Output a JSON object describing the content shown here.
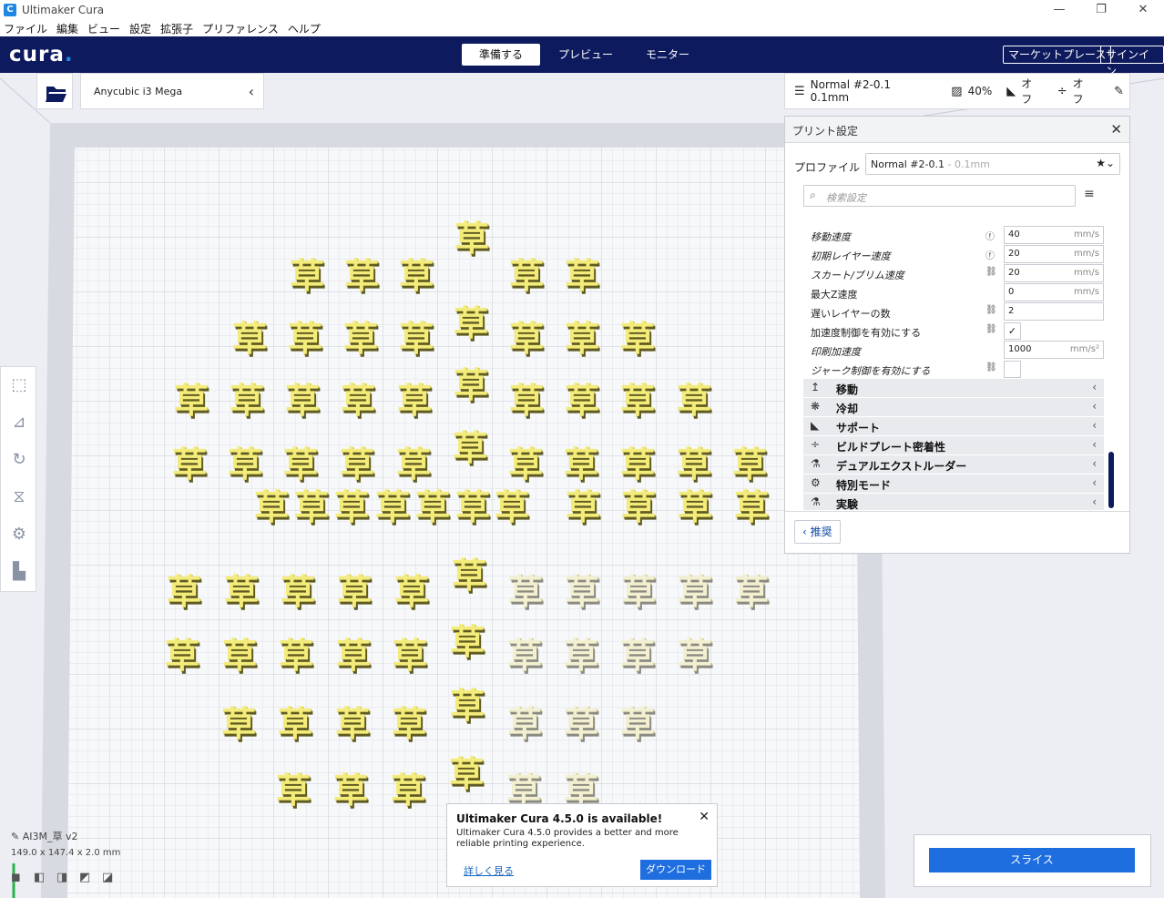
{
  "window": {
    "title": "Ultimaker Cura",
    "icon_glyph": "C"
  },
  "menu": [
    "ファイル",
    "編集",
    "ビュー",
    "設定",
    "拡張子",
    "プリファレンス",
    "ヘルプ"
  ],
  "header": {
    "logo": "cura",
    "logo_dot": ".",
    "stages": [
      "準備する",
      "プレビュー",
      "モニター"
    ],
    "active_stage": "準備する",
    "marketplace": "マーケットプレース",
    "signin": "サインイン"
  },
  "machine": {
    "name": "Anycubic i3 Mega"
  },
  "print_summary": {
    "profile": "Normal #2-0.1 0.1mm",
    "infill": "40%",
    "support": "オフ",
    "adhesion": "オフ"
  },
  "print_settings": {
    "title": "プリント設定",
    "profile_label": "プロファイル",
    "profile_value": "Normal #2-0.1",
    "profile_sub": " - 0.1mm",
    "search_placeholder": "検索設定",
    "rows": [
      {
        "label": "移動速度",
        "value": "40",
        "unit": "mm/s",
        "type": "field",
        "italic": true,
        "indicator": "f"
      },
      {
        "label": "初期レイヤー速度",
        "value": "20",
        "unit": "mm/s",
        "type": "field",
        "italic": true,
        "indicator": "f"
      },
      {
        "label": "スカート/ブリム速度",
        "value": "20",
        "unit": "mm/s",
        "type": "field",
        "italic": true,
        "indicator": "link"
      },
      {
        "label": "最大Z速度",
        "value": "0",
        "unit": "mm/s",
        "type": "field",
        "italic": false,
        "indicator": ""
      },
      {
        "label": "遅いレイヤーの数",
        "value": "2",
        "unit": "",
        "type": "field",
        "italic": false,
        "indicator": "link"
      },
      {
        "label": "加速度制御を有効にする",
        "value": "✓",
        "unit": "",
        "type": "check",
        "italic": false,
        "indicator": "link"
      },
      {
        "label": "印刷加速度",
        "value": "1000",
        "unit": "mm/s²",
        "type": "field",
        "italic": true,
        "indicator": ""
      },
      {
        "label": "ジャーク制御を有効にする",
        "value": "",
        "unit": "",
        "type": "check",
        "italic": true,
        "indicator": "link"
      }
    ],
    "categories": [
      {
        "label": "移動",
        "icon": "travel-icon"
      },
      {
        "label": "冷却",
        "icon": "cooling-fan-icon"
      },
      {
        "label": "サポート",
        "icon": "support-icon"
      },
      {
        "label": "ビルドプレート密着性",
        "icon": "adhesion-icon"
      },
      {
        "label": "デュアルエクストルーダー",
        "icon": "dual-extruder-icon"
      },
      {
        "label": "特別モード",
        "icon": "special-mode-icon"
      },
      {
        "label": "実験",
        "icon": "experimental-icon"
      }
    ],
    "recommended": "推奨"
  },
  "model": {
    "glyph": "草",
    "color": "#f4ec7a"
  },
  "object": {
    "name": "AI3M_草 v2",
    "dims": "149.0 x 147.4 x 2.0 mm"
  },
  "notification": {
    "title": "Ultimaker Cura 4.5.0 is available!",
    "message": "Ultimaker Cura 4.5.0 provides a better and more reliable printing experience.",
    "learn_more": "詳しく見る",
    "download": "ダウンロード"
  },
  "slice": {
    "label": "スライス"
  },
  "colors": {
    "header": "#0d1a5e",
    "accent": "#1e6ee0"
  }
}
